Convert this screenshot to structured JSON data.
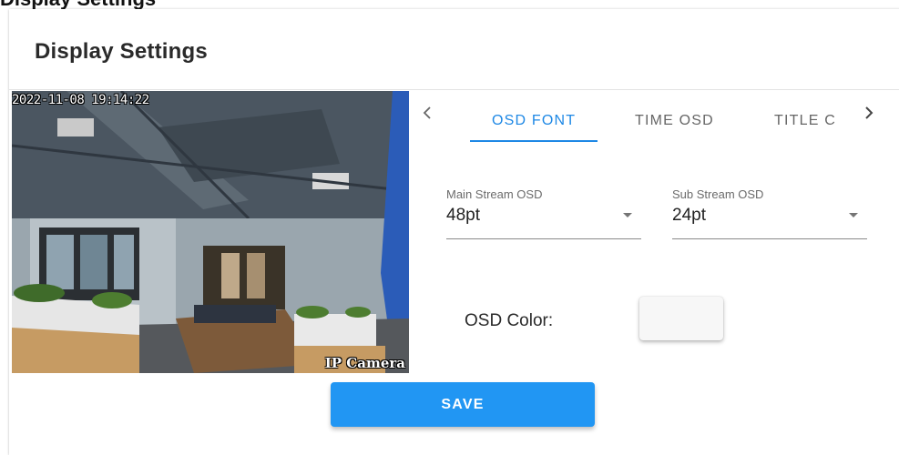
{
  "page": {
    "title": "Display Settings"
  },
  "card": {
    "title": "Display Settings"
  },
  "preview": {
    "timestamp": "2022-11-08 19:14:22",
    "camera_title": "IP Camera"
  },
  "tabs": {
    "items": [
      {
        "label": "OSD FONT",
        "active": true
      },
      {
        "label": "TIME OSD",
        "active": false
      },
      {
        "label": "TITLE C",
        "active": false
      }
    ],
    "prev_icon": "chevron-left-icon",
    "next_icon": "chevron-right-icon"
  },
  "fields": {
    "main_stream": {
      "label": "Main Stream OSD",
      "value": "48pt"
    },
    "sub_stream": {
      "label": "Sub Stream OSD",
      "value": "24pt"
    }
  },
  "osd_color": {
    "label": "OSD Color:",
    "value": "#f7f7f7"
  },
  "actions": {
    "save_label": "SAVE"
  },
  "colors": {
    "accent": "#1e88e5",
    "button": "#2196f3"
  }
}
